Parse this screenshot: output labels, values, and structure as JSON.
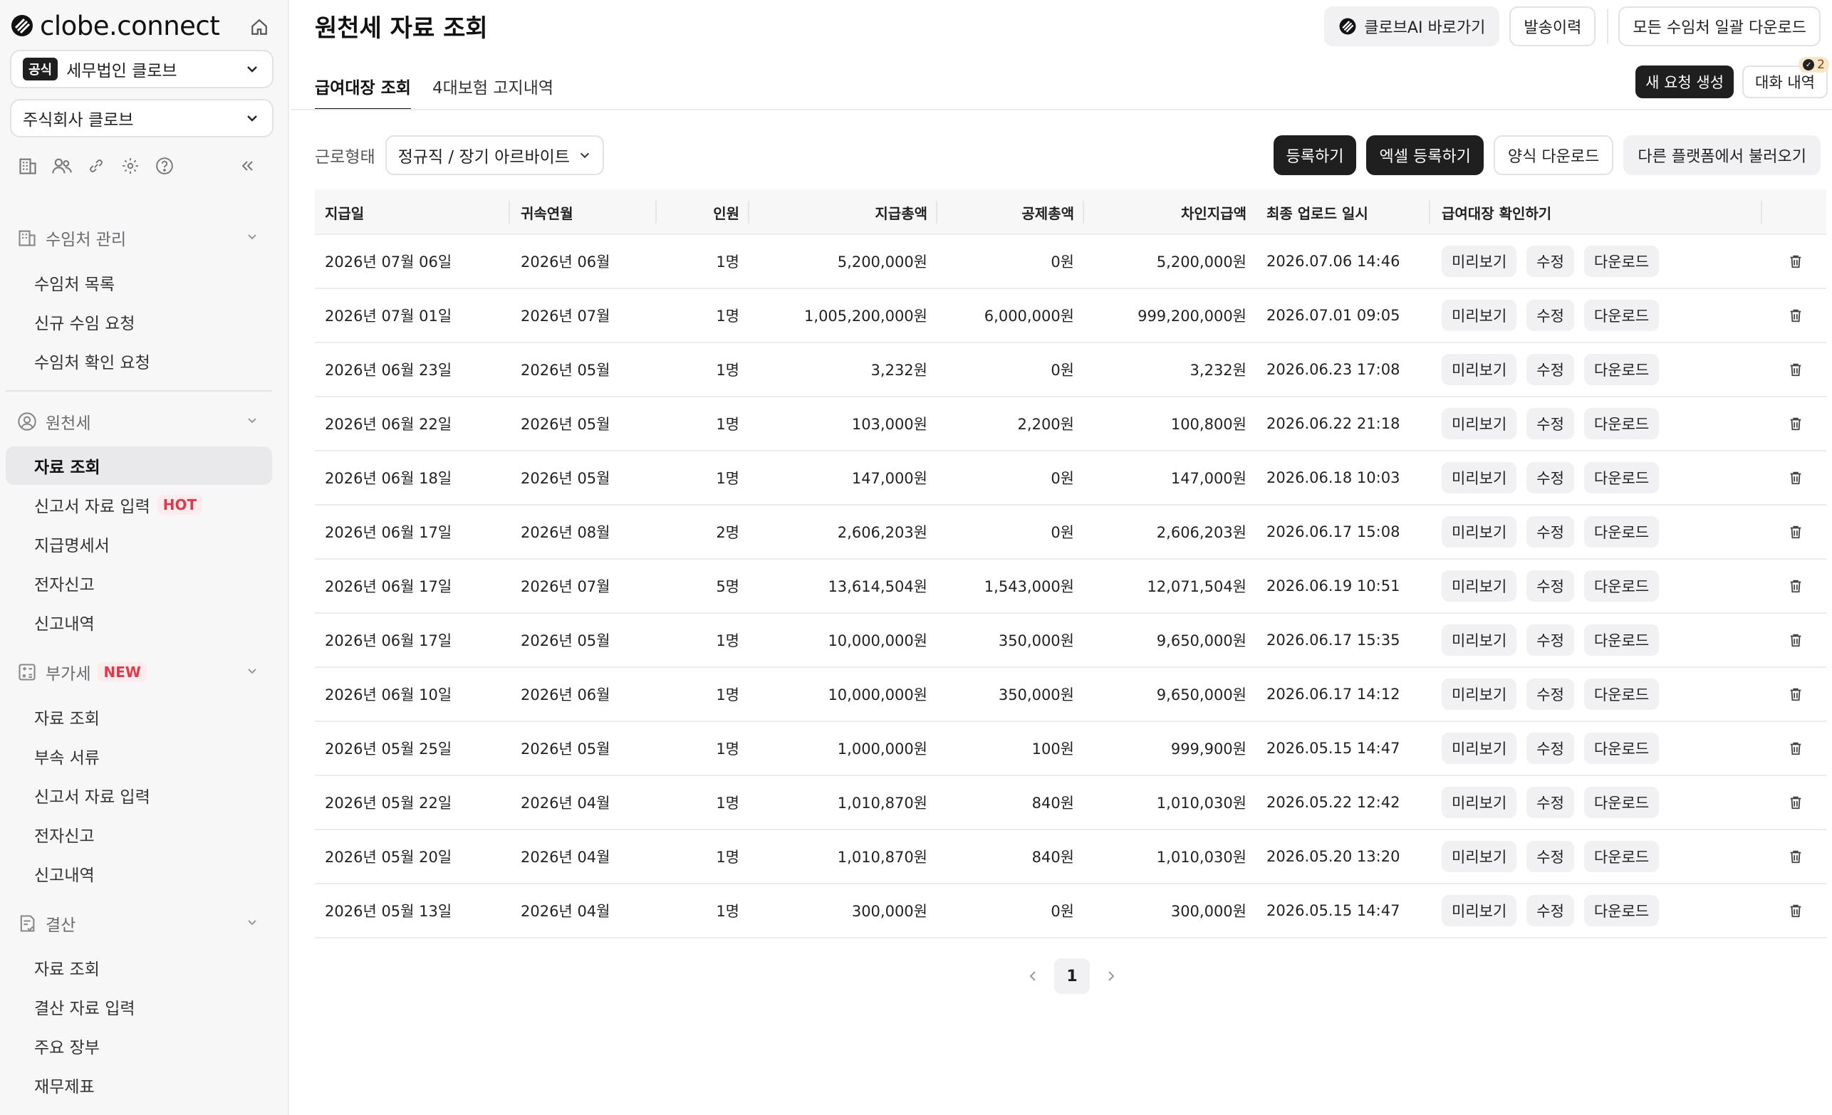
{
  "brand": {
    "name": "clobe.connect"
  },
  "sidebar": {
    "firm_badge": "공식",
    "firm_name": "세무법인 클로브",
    "company_name": "주식회사 클로브",
    "sections": {
      "clients": {
        "label": "수임처 관리",
        "items": [
          "수임처 목록",
          "신규 수임 요청",
          "수임처 확인 요청"
        ]
      },
      "withholding": {
        "label": "원천세",
        "items": [
          "자료 조회",
          "신고서 자료 입력",
          "지급명세서",
          "전자신고",
          "신고내역"
        ],
        "hot_tag": "HOT"
      },
      "vat": {
        "label": "부가세",
        "new_tag": "NEW",
        "items": [
          "자료 조회",
          "부속 서류",
          "신고서 자료 입력",
          "전자신고",
          "신고내역"
        ]
      },
      "settlement": {
        "label": "결산",
        "items": [
          "자료 조회",
          "결산 자료 입력",
          "주요 장부",
          "재무제표"
        ]
      }
    }
  },
  "header": {
    "title": "원천세 자료 조회",
    "ai_button": "클로브AI 바로가기",
    "history_button": "발송이력",
    "download_all_button": "모든 수임처 일괄 다운로드"
  },
  "tabs": {
    "payroll": "급여대장 조회",
    "insurance": "4대보험 고지내역"
  },
  "tab_actions": {
    "new_request": "새 요청 생성",
    "chat_history": "대화 내역",
    "chat_count": "2"
  },
  "filter": {
    "label": "근로형태",
    "value": "정규직 / 장기 아르바이트"
  },
  "actions": {
    "register": "등록하기",
    "excel_register": "엑셀 등록하기",
    "template_download": "양식 다운로드",
    "import_other": "다른 플랫폼에서 불러오기"
  },
  "table": {
    "headers": {
      "pay_date": "지급일",
      "period": "귀속연월",
      "people": "인원",
      "total_pay": "지급총액",
      "total_deduction": "공제총액",
      "net_pay": "차인지급액",
      "last_upload": "최종 업로드 일시",
      "check": "급여대장 확인하기"
    },
    "row_actions": {
      "preview": "미리보기",
      "edit": "수정",
      "download": "다운로드"
    },
    "rows": [
      {
        "pay_date": "2026년 07월 06일",
        "period": "2026년 06월",
        "people": "1명",
        "total_pay": "5,200,000원",
        "total_deduction": "0원",
        "net_pay": "5,200,000원",
        "last_upload": "2026.07.06 14:46"
      },
      {
        "pay_date": "2026년 07월 01일",
        "period": "2026년 07월",
        "people": "1명",
        "total_pay": "1,005,200,000원",
        "total_deduction": "6,000,000원",
        "net_pay": "999,200,000원",
        "last_upload": "2026.07.01 09:05"
      },
      {
        "pay_date": "2026년 06월 23일",
        "period": "2026년 05월",
        "people": "1명",
        "total_pay": "3,232원",
        "total_deduction": "0원",
        "net_pay": "3,232원",
        "last_upload": "2026.06.23 17:08"
      },
      {
        "pay_date": "2026년 06월 22일",
        "period": "2026년 05월",
        "people": "1명",
        "total_pay": "103,000원",
        "total_deduction": "2,200원",
        "net_pay": "100,800원",
        "last_upload": "2026.06.22 21:18"
      },
      {
        "pay_date": "2026년 06월 18일",
        "period": "2026년 05월",
        "people": "1명",
        "total_pay": "147,000원",
        "total_deduction": "0원",
        "net_pay": "147,000원",
        "last_upload": "2026.06.18 10:03"
      },
      {
        "pay_date": "2026년 06월 17일",
        "period": "2026년 08월",
        "people": "2명",
        "total_pay": "2,606,203원",
        "total_deduction": "0원",
        "net_pay": "2,606,203원",
        "last_upload": "2026.06.17 15:08"
      },
      {
        "pay_date": "2026년 06월 17일",
        "period": "2026년 07월",
        "people": "5명",
        "total_pay": "13,614,504원",
        "total_deduction": "1,543,000원",
        "net_pay": "12,071,504원",
        "last_upload": "2026.06.19 10:51"
      },
      {
        "pay_date": "2026년 06월 17일",
        "period": "2026년 05월",
        "people": "1명",
        "total_pay": "10,000,000원",
        "total_deduction": "350,000원",
        "net_pay": "9,650,000원",
        "last_upload": "2026.06.17 15:35"
      },
      {
        "pay_date": "2026년 06월 10일",
        "period": "2026년 06월",
        "people": "1명",
        "total_pay": "10,000,000원",
        "total_deduction": "350,000원",
        "net_pay": "9,650,000원",
        "last_upload": "2026.06.17 14:12"
      },
      {
        "pay_date": "2026년 05월 25일",
        "period": "2026년 05월",
        "people": "1명",
        "total_pay": "1,000,000원",
        "total_deduction": "100원",
        "net_pay": "999,900원",
        "last_upload": "2026.05.15 14:47"
      },
      {
        "pay_date": "2026년 05월 22일",
        "period": "2026년 04월",
        "people": "1명",
        "total_pay": "1,010,870원",
        "total_deduction": "840원",
        "net_pay": "1,010,030원",
        "last_upload": "2026.05.22 12:42"
      },
      {
        "pay_date": "2026년 05월 20일",
        "period": "2026년 04월",
        "people": "1명",
        "total_pay": "1,010,870원",
        "total_deduction": "840원",
        "net_pay": "1,010,030원",
        "last_upload": "2026.05.20 13:20"
      },
      {
        "pay_date": "2026년 05월 13일",
        "period": "2026년 04월",
        "people": "1명",
        "total_pay": "300,000원",
        "total_deduction": "0원",
        "net_pay": "300,000원",
        "last_upload": "2026.05.15 14:47"
      }
    ]
  },
  "pagination": {
    "current": "1"
  },
  "colors": {
    "accent": "#1f1f1f",
    "tag_red": "#e0394a",
    "sidebar_bg": "#f7f7f8"
  }
}
